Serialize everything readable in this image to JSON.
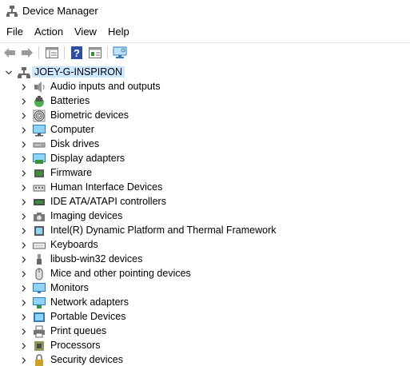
{
  "window": {
    "title": "Device Manager"
  },
  "menu": [
    "File",
    "Action",
    "View",
    "Help"
  ],
  "toolbar": [
    "back-arrow-icon",
    "forward-arrow-icon",
    "properties-icon",
    "help-icon",
    "device-properties-icon",
    "monitor-scan-icon"
  ],
  "tree": {
    "root": "JOEY-G-INSPIRON",
    "items": [
      {
        "label": "Audio inputs and outputs",
        "icon": "speaker-icon"
      },
      {
        "label": "Batteries",
        "icon": "battery-icon"
      },
      {
        "label": "Biometric devices",
        "icon": "fingerprint-icon"
      },
      {
        "label": "Computer",
        "icon": "computer-icon"
      },
      {
        "label": "Disk drives",
        "icon": "disk-drive-icon"
      },
      {
        "label": "Display adapters",
        "icon": "display-adapter-icon"
      },
      {
        "label": "Firmware",
        "icon": "firmware-icon"
      },
      {
        "label": "Human Interface Devices",
        "icon": "hid-icon"
      },
      {
        "label": "IDE ATA/ATAPI controllers",
        "icon": "ide-controller-icon"
      },
      {
        "label": "Imaging devices",
        "icon": "camera-icon"
      },
      {
        "label": "Intel(R) Dynamic Platform and Thermal Framework",
        "icon": "chip-icon"
      },
      {
        "label": "Keyboards",
        "icon": "keyboard-icon"
      },
      {
        "label": "libusb-win32 devices",
        "icon": "usb-icon"
      },
      {
        "label": "Mice and other pointing devices",
        "icon": "mouse-icon"
      },
      {
        "label": "Monitors",
        "icon": "monitor-icon"
      },
      {
        "label": "Network adapters",
        "icon": "network-adapter-icon"
      },
      {
        "label": "Portable Devices",
        "icon": "portable-device-icon"
      },
      {
        "label": "Print queues",
        "icon": "printer-icon"
      },
      {
        "label": "Processors",
        "icon": "processor-icon"
      },
      {
        "label": "Security devices",
        "icon": "security-device-icon"
      }
    ]
  }
}
